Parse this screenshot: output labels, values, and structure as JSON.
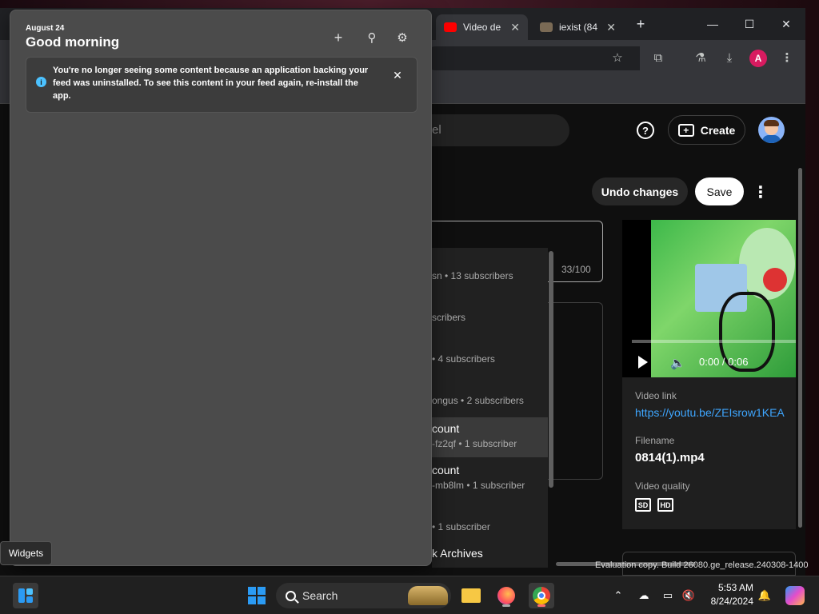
{
  "browser": {
    "tabs": [
      {
        "title": "Video de",
        "close": "✕"
      },
      {
        "title": "iexist (84",
        "close": "✕"
      }
    ],
    "new_tab": "+",
    "window_controls": {
      "minimize": "—",
      "maximize": "☐",
      "close": "✕"
    },
    "profile_initial": "A"
  },
  "youtube": {
    "search_placeholder": "el",
    "help": "?",
    "create_label": "Create",
    "undo_label": "Undo changes",
    "save_label": "Save",
    "char_count": "33/100",
    "channels": [
      {
        "name": "",
        "sub": "sn • 13 subscribers"
      },
      {
        "name": "",
        "sub": "scribers"
      },
      {
        "name": "",
        "sub": "• 4 subscribers"
      },
      {
        "name": "",
        "sub": "ongus • 2 subscribers"
      },
      {
        "name": "count",
        "sub": "-fz2qf • 1 subscriber",
        "selected": true
      },
      {
        "name": "count",
        "sub": "-mb8lm • 1 subscriber"
      },
      {
        "name": "",
        "sub": "• 1 subscriber"
      },
      {
        "name": "k Archives",
        "sub": ""
      }
    ],
    "player": {
      "time": "0:00 / 0:06"
    },
    "video_link_label": "Video link",
    "video_link": "https://youtu.be/ZEIsrow1KEA",
    "filename_label": "Filename",
    "filename": "0814(1).mp4",
    "quality_label": "Video quality",
    "quality_badges": [
      "SD",
      "HD"
    ]
  },
  "widgets": {
    "date": "August 24",
    "greeting": "Good morning",
    "notice": "You're no longer seeing some content because an application backing your feed was uninstalled. To see this content in your feed again, re-install the app.",
    "info_glyph": "i"
  },
  "tooltip": "Widgets",
  "watermark": "Evaluation copy. Build 26080.ge_release.240308-1400",
  "taskbar": {
    "search_label": "Search",
    "time": "5:53 AM",
    "date": "8/24/2024"
  },
  "colors": {
    "accent_blue": "#3ea6ff",
    "youtube_red": "#ff0000",
    "windows_blue": "#2b9bf4"
  }
}
